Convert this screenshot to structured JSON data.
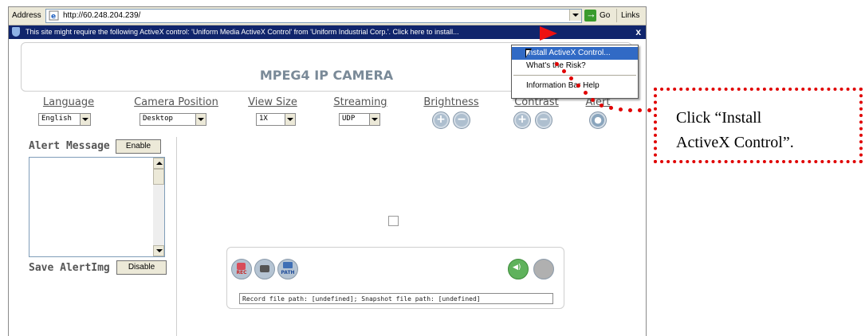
{
  "browser": {
    "address_label": "Address",
    "url": "http://60.248.204.239/",
    "go_label": "Go",
    "links_label": "Links",
    "infobar_text": "This site might require the following ActiveX control: 'Uniform Media ActiveX Control' from 'Uniform Industrial Corp.'. Click here to install...",
    "infobar_close": "x"
  },
  "context_menu": {
    "items": [
      {
        "label": "Install ActiveX Control...",
        "highlighted": true
      },
      {
        "label": "What's the Risk?",
        "highlighted": false
      },
      {
        "label": "Information Bar Help",
        "highlighted": false
      }
    ]
  },
  "camera": {
    "title": "MPEG4 IP CAMERA",
    "language": {
      "label": "Language",
      "value": "English"
    },
    "camera_position": {
      "label": "Camera Position",
      "value": "Desktop"
    },
    "view_size": {
      "label": "View Size",
      "value": "1X"
    },
    "streaming": {
      "label": "Streaming",
      "value": "UDP"
    },
    "brightness": {
      "label": "Brightness",
      "plus": "+",
      "minus": "−"
    },
    "contrast": {
      "label": "Contrast",
      "plus": "+",
      "minus": "−"
    },
    "alert": {
      "label": "Alert"
    },
    "alert_message_label": "Alert Message",
    "enable_button": "Enable",
    "save_alertimg_label": "Save AlertImg",
    "disable_button": "Disable",
    "controls": {
      "rec_label": "REC",
      "path_label": "PATH",
      "path_text": "Record file path: [undefined]; Snapshot file path: [undefined]"
    }
  },
  "annotation": {
    "line1": "Click “Install",
    "line2": "ActiveX Control”."
  },
  "colors": {
    "highlight": "#316ac5",
    "infobar": "#10256c",
    "annotation": "#e00000"
  }
}
